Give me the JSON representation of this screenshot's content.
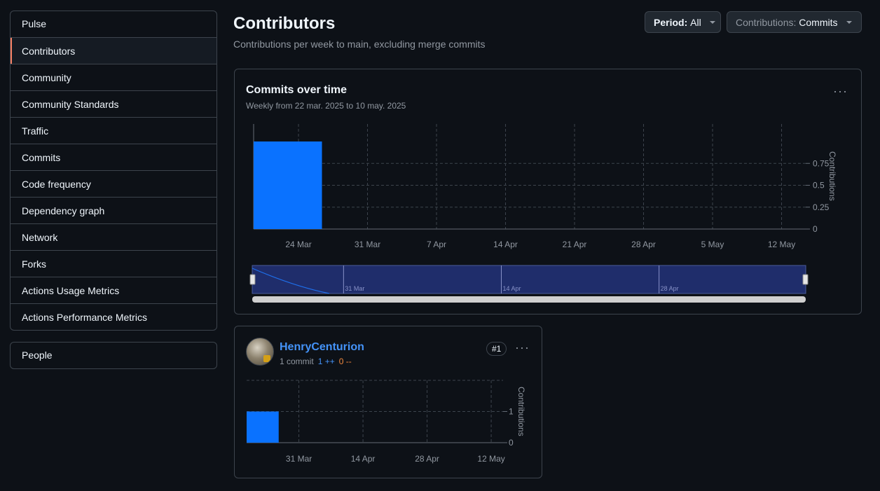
{
  "sidebar": {
    "items": [
      {
        "label": "Pulse"
      },
      {
        "label": "Contributors"
      },
      {
        "label": "Community"
      },
      {
        "label": "Community Standards"
      },
      {
        "label": "Traffic"
      },
      {
        "label": "Commits"
      },
      {
        "label": "Code frequency"
      },
      {
        "label": "Dependency graph"
      },
      {
        "label": "Network"
      },
      {
        "label": "Forks"
      },
      {
        "label": "Actions Usage Metrics"
      },
      {
        "label": "Actions Performance Metrics"
      }
    ],
    "active_item": "Contributors",
    "people_label": "People"
  },
  "header": {
    "title": "Contributors",
    "subtitle": "Contributions per week to main, excluding merge commits"
  },
  "filters": {
    "period_key": "Period:",
    "period_value": "All",
    "contrib_key": "Contributions:",
    "contrib_value": "Commits"
  },
  "main_chart": {
    "title": "Commits over time",
    "subtitle": "Weekly from 22 mar. 2025 to 10 may. 2025",
    "menu": "···"
  },
  "contributor": {
    "name": "HenryCenturion",
    "commits": "1 commit",
    "additions": "1 ++",
    "deletions": "0 --",
    "rank": "#1",
    "menu": "···"
  },
  "colors": {
    "bar": "#0a72ff",
    "accent_active": "#f78166",
    "link": "#4493f8",
    "deletions": "#f0883e"
  },
  "chart_data": [
    {
      "type": "bar",
      "title": "Commits over time",
      "x_ticks": [
        "24 Mar",
        "31 Mar",
        "7 Apr",
        "14 Apr",
        "21 Apr",
        "28 Apr",
        "5 May",
        "12 May"
      ],
      "y_ticks": [
        "0",
        "0.25",
        "0.5",
        "0.75"
      ],
      "ylabel": "Contributions",
      "ylim": [
        0,
        1.2
      ],
      "weeks": [
        "2025-03-22",
        "2025-03-29",
        "2025-04-05",
        "2025-04-12",
        "2025-04-19",
        "2025-04-26",
        "2025-05-03",
        "2025-05-10"
      ],
      "values": [
        1,
        0,
        0,
        0,
        0,
        0,
        0,
        0
      ],
      "grid": true,
      "navigator_labels": [
        "31 Mar",
        "14 Apr",
        "28 Apr"
      ]
    },
    {
      "type": "bar",
      "title": "HenryCenturion",
      "x_ticks": [
        "31 Mar",
        "14 Apr",
        "28 Apr",
        "12 May"
      ],
      "y_ticks": [
        "0",
        "1"
      ],
      "ylabel": "Contributions",
      "ylim": [
        0,
        2
      ],
      "values": [
        1,
        0,
        0,
        0,
        0,
        0,
        0,
        0
      ],
      "grid": true
    }
  ]
}
